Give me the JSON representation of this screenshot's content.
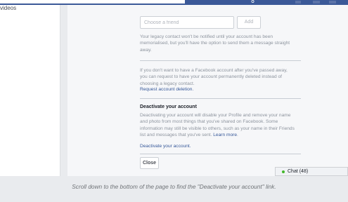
{
  "sidebar": {
    "label": "videos"
  },
  "legacy": {
    "friend_placeholder": "Choose a friend",
    "add_label": "Add",
    "notice_line1": "Your legacy contact won't be notified until your account has been",
    "notice_line2": "memorialised, but you'll have the option to send them a message straight",
    "notice_line3": "away."
  },
  "deletion": {
    "line1": "If you don't want to have a Facebook account after you've passed away,",
    "line2": "you can request to have your account permanently deleted instead of",
    "line3": "choosing a legacy contact.",
    "link": "Request account deletion."
  },
  "deactivate": {
    "title": "Deactivate your account",
    "line1": "Deactivating your account will disable your Profile and remove your name",
    "line2": "and photo from most things that you've shared on Facebook. Some",
    "line3": "information may still be visible to others, such as your name in their Friends",
    "line4_text": "list and messages that you've sent. ",
    "learn_more": "Learn more",
    "learn_more_suffix": ".",
    "link": "Deactivate your account."
  },
  "close_label": "Close",
  "chat": {
    "label": "Chat (48)",
    "status_color": "#42b72a"
  },
  "caption": "Scroll down to the bottom of the page to find the \"Deactivate your account\" link.",
  "colors": {
    "brand": "#3b5998",
    "link": "#365899"
  }
}
